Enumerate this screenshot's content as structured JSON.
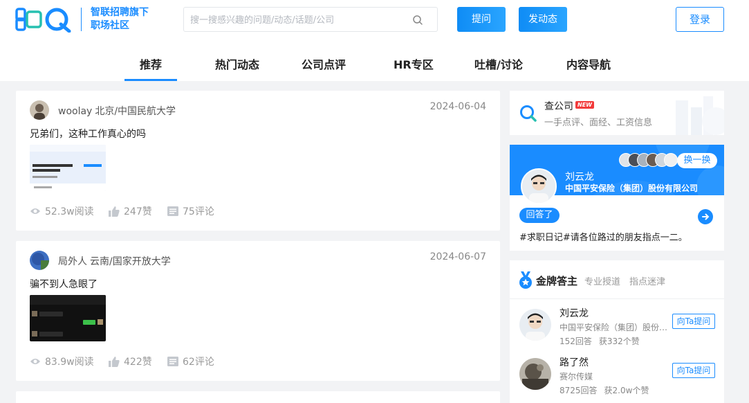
{
  "header": {
    "slogan_line1": "智联招聘旗下",
    "slogan_line2": "职场社区",
    "search_placeholder": "搜一搜感兴趣的问题/动态/话题/公司",
    "ask_label": "提问",
    "post_label": "发动态",
    "login_label": "登录"
  },
  "nav": {
    "tabs": [
      {
        "label": "推荐"
      },
      {
        "label": "热门动态"
      },
      {
        "label": "公司点评"
      },
      {
        "label": "HR专区"
      },
      {
        "label": "吐槽/讨论"
      },
      {
        "label": "内容导航"
      }
    ],
    "active": "推荐"
  },
  "feed": [
    {
      "author": "woolay",
      "school": "北京/中国民航大学",
      "date": "2024-06-04",
      "text": "兄弟们，这种工作真心的吗",
      "views": "52.3w阅读",
      "likes": "247赞",
      "comments": "75评论"
    },
    {
      "author": "局外人",
      "school": "云南/国家开放大学",
      "date": "2024-06-07",
      "text": "骗不到人急眼了",
      "views": "83.9w阅读",
      "likes": "422赞",
      "comments": "62评论"
    }
  ],
  "sidebar": {
    "company": {
      "title": "查公司",
      "badge": "NEW",
      "subtitle": "一手点评、面经、工资信息"
    },
    "answer": {
      "name": "刘云龙",
      "company": "中国平安保险（集团）股份有限公司",
      "swap_label": "换一换",
      "answered_label": "回答了",
      "question": "#求职日记#请各位路过的朋友指点一二。"
    },
    "gold": {
      "title": "金牌答主",
      "tag1": "专业授道",
      "tag2": "指点迷津",
      "ask_label": "向Ta提问",
      "items": [
        {
          "name": "刘云龙",
          "company": "中国平安保险（集团）股份有限公司",
          "answers": "152回答",
          "likes": "获332个赞"
        },
        {
          "name": "路了然",
          "company": "赛尔传媒",
          "answers": "8725回答",
          "likes": "获2.0w个赞"
        }
      ]
    }
  },
  "colors": {
    "accent": "#1a8cff",
    "badge_red": "#f23b3b"
  }
}
